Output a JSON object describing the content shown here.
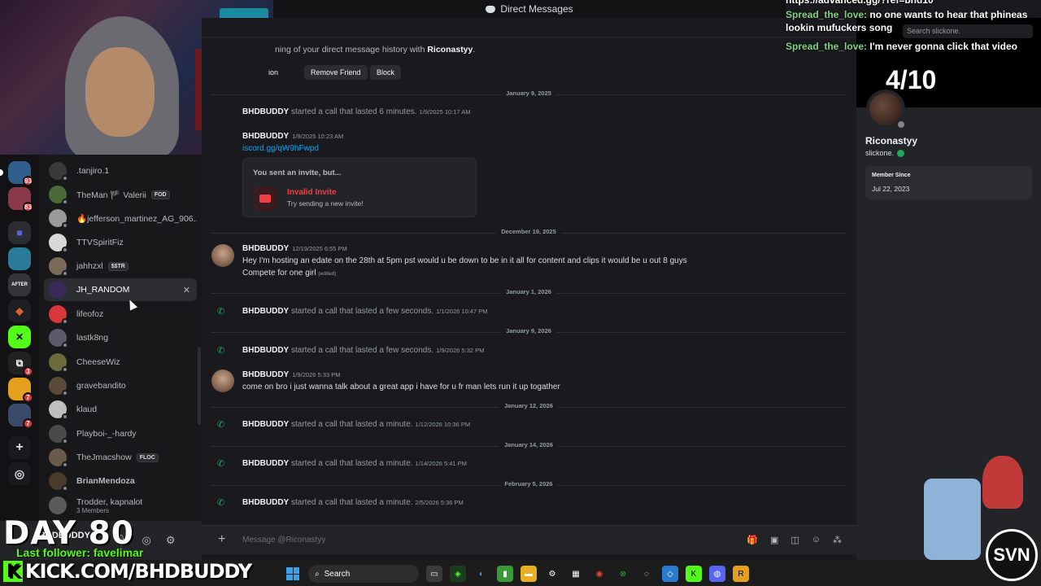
{
  "titlebar": {
    "title": "Direct Messages"
  },
  "servers": [
    {
      "badge": "93",
      "color": "#2f5f8a"
    },
    {
      "badge": "83",
      "color": "#8a3a4a"
    },
    {
      "badge": "",
      "color": "#5865f2"
    },
    {
      "badge": "",
      "color": "#2a7a9a"
    },
    {
      "badge": "",
      "color": "#333338"
    },
    {
      "badge": "",
      "color": "#e0642a"
    },
    {
      "badge": "",
      "color": "#53fc18"
    },
    {
      "badge": "3",
      "color": "#222"
    },
    {
      "badge": "7",
      "color": "#e6a020"
    },
    {
      "badge": "7",
      "color": "#3a4a6a"
    }
  ],
  "dms": [
    {
      "name": ".tanjiro.1",
      "color": "#3a3a3a",
      "tag": ""
    },
    {
      "name": "TheMan 🏴 Valerii",
      "color": "#4a6a3a",
      "tag": "FOD"
    },
    {
      "name": "🔥jefferson_martinez_AG_906...",
      "color": "#9a9a9a",
      "tag": ""
    },
    {
      "name": "TTVSpiritFiz",
      "color": "#d8d8d8",
      "tag": ""
    },
    {
      "name": "jahhzxl",
      "color": "#7a6a5a",
      "tag": "$$TR"
    },
    {
      "name": "JH_RANDOM",
      "color": "#3a2a5a",
      "tag": ""
    },
    {
      "name": "lifeofoz",
      "color": "#da373c",
      "tag": ""
    },
    {
      "name": "lastk8ng",
      "color": "#5a5a6a",
      "tag": ""
    },
    {
      "name": "CheeseWiz",
      "color": "#6a6a3a",
      "tag": ""
    },
    {
      "name": "gravebandito",
      "color": "#5a4a3a",
      "tag": ""
    },
    {
      "name": "klaud",
      "color": "#bfbfbf",
      "tag": ""
    },
    {
      "name": "Playboi-_-hardy",
      "color": "#4a4a4a",
      "tag": ""
    },
    {
      "name": "TheJmacshow",
      "color": "#6a5a4a",
      "tag": "FLOC"
    },
    {
      "name": "BrianMendoza",
      "color": "#4a3a2a",
      "tag": ""
    },
    {
      "name": "Trodder, kapnalot",
      "color": "#5a5a5a",
      "tag": "",
      "sub": "3 Members"
    }
  ],
  "user_panel": {
    "name": "BHDBUDDY"
  },
  "chat": {
    "beginning": "ning of your direct message history with ",
    "beginning_user": "Riconastyy",
    "btn_partial": "ion",
    "btn_remove": "Remove Friend",
    "btn_block": "Block",
    "dates": [
      "January 9, 2025",
      "December 19, 2025",
      "January 1, 2026",
      "January 9, 2026",
      "January 12, 2026",
      "January 14, 2026",
      "February 5, 2026"
    ],
    "call1": {
      "author": "BHDBUDDY",
      "text": "started a call that lasted 6 minutes.",
      "ts": "1/9/2025 10:17 AM"
    },
    "link_msg": {
      "author": "BHDBUDDY",
      "ts": "1/9/2025 10:23 AM",
      "link": "iscord.gg/qW9hFwpd"
    },
    "invite": {
      "title": "You sent an invite, but...",
      "name": "Invalid Invite",
      "sub": "Try sending a new invite!"
    },
    "msg1": {
      "author": "BHDBUDDY",
      "ts": "12/19/2025 6:55 PM",
      "line1": "Hey I'm hosting an edate on the 28th at 5pm pst would u be down to be in it all for content and clips it would be u out 8 guys",
      "line2": "Compete for one girl",
      "edited": "(edited)"
    },
    "call2": {
      "author": "BHDBUDDY",
      "text": "started a call that lasted a few seconds.",
      "ts": "1/1/2026 10:47 PM"
    },
    "call3": {
      "author": "BHDBUDDY",
      "text": "started a call that lasted a few seconds.",
      "ts": "1/9/2026 5:32 PM"
    },
    "msg2": {
      "author": "BHDBUDDY",
      "ts": "1/9/2026 5:33 PM",
      "line1": "come on bro i just wanna talk about a great app i have for u fr man lets run it up togather"
    },
    "call4": {
      "author": "BHDBUDDY",
      "text": "started a call that lasted a minute.",
      "ts": "1/12/2026 10:36 PM"
    },
    "call5": {
      "author": "BHDBUDDY",
      "text": "started a call that lasted a minute.",
      "ts": "1/14/2026 5:41 PM"
    },
    "call6": {
      "author": "BHDBUDDY",
      "text": "started a call that lasted a minute.",
      "ts": "2/5/2026 5:36 PM"
    },
    "composer_placeholder": "Message @Riconastyy"
  },
  "profile": {
    "rating": "4/10",
    "display_name": "Riconastyy",
    "username": "slickone.",
    "member_since_label": "Member Since",
    "member_since": "Jul 22, 2023"
  },
  "overlay": {
    "chat1_user": "Spread_the_love:",
    "chat1_text": " no one wants to hear that phineas lookin mufuckers song",
    "chat2_user": "Spread_the_love:",
    "chat2_text": " I'm never gonna click that video",
    "url_fragment": "https://advanced.gg/?ref=bhd10",
    "search_placeholder": "Search slickone.",
    "day": "DAY 80",
    "last_follower": "Last follower: favelimar",
    "kick_url": "KICK.COM/BHDBUDDY",
    "logo": "SVN"
  },
  "taskbar": {
    "search_label": "Search"
  }
}
